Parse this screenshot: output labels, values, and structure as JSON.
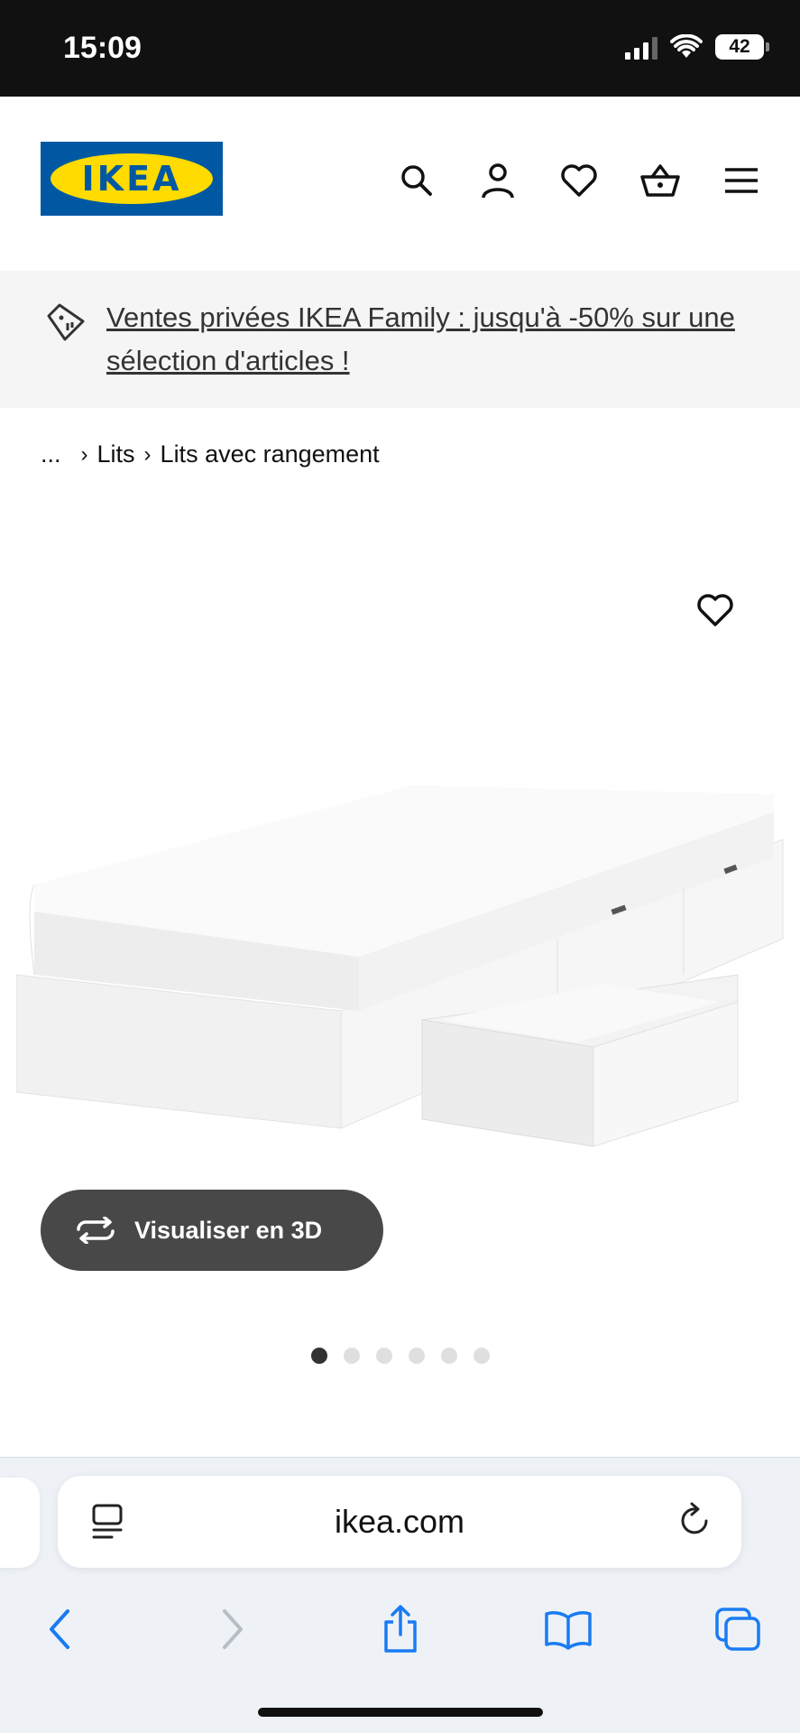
{
  "status_bar": {
    "time": "15:09",
    "battery": "42"
  },
  "header": {
    "logo_text": "IKEA",
    "icons": [
      "search-icon",
      "account-icon",
      "heart-icon",
      "basket-icon",
      "menu-icon"
    ]
  },
  "promo": {
    "text": "Ventes privées IKEA Family : jusqu'à -50% sur une sélection d'articles !"
  },
  "breadcrumb": {
    "ellipsis": "...",
    "items": [
      "Lits",
      "Lits avec rangement"
    ]
  },
  "product": {
    "view_3d_label": "Visualiser en 3D",
    "image_count": 6,
    "active_image": 1
  },
  "browser": {
    "url": "ikea.com"
  },
  "colors": {
    "ikea_blue": "#0058a3",
    "ikea_yellow": "#ffdb00",
    "safari_blue": "#1a7bf2"
  }
}
